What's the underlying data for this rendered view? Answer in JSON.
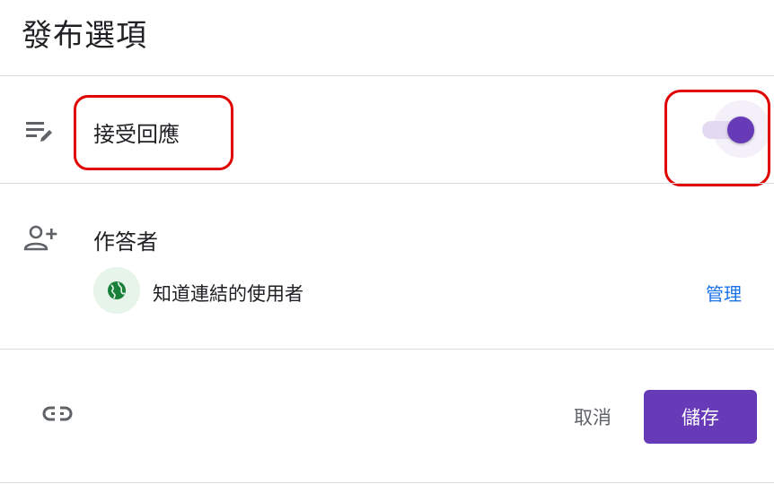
{
  "dialog": {
    "title": "發布選項"
  },
  "accept_responses": {
    "icon": "edit-list-icon",
    "label": "接受回應",
    "toggle_on": true,
    "accent_color": "#673ab7"
  },
  "respondents": {
    "icon": "person-add-icon",
    "label": "作答者",
    "audience_icon": "globe-icon",
    "audience_label": "知道連結的使用者",
    "manage_label": "管理"
  },
  "footer": {
    "link_icon": "link-icon",
    "cancel_label": "取消",
    "save_label": "儲存"
  },
  "colors": {
    "highlight": "#e00000",
    "link": "#1a73e8",
    "primary": "#673ab7"
  }
}
